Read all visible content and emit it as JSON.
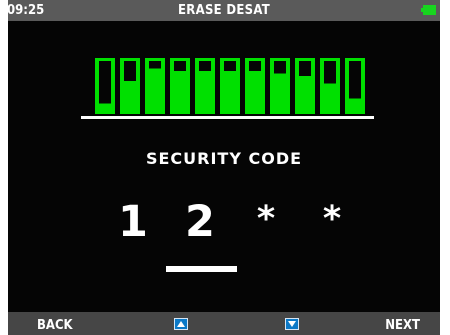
{
  "status_bar": {
    "time": "09:25",
    "title": "ERASE DESAT",
    "battery_icon": "battery-full-icon",
    "battery_color": "#18d51f"
  },
  "pin_graphic": {
    "icon": "pin-tumbler-lock-icon",
    "pin_color": "#00e000",
    "pins_raised_levels": [
      0.15,
      0.6,
      0.85,
      0.8,
      0.8,
      0.8,
      0.8,
      0.75,
      0.7,
      0.55,
      0.25
    ]
  },
  "security_code": {
    "label": "SECURITY CODE",
    "digits": [
      "1",
      "2",
      "*",
      "*"
    ],
    "active_index": 1
  },
  "softkeys": {
    "back_label": "BACK",
    "up_icon": "arrow-up-icon",
    "down_icon": "arrow-down-icon",
    "next_label": "NEXT",
    "arrow_color": "#0b79c7"
  }
}
